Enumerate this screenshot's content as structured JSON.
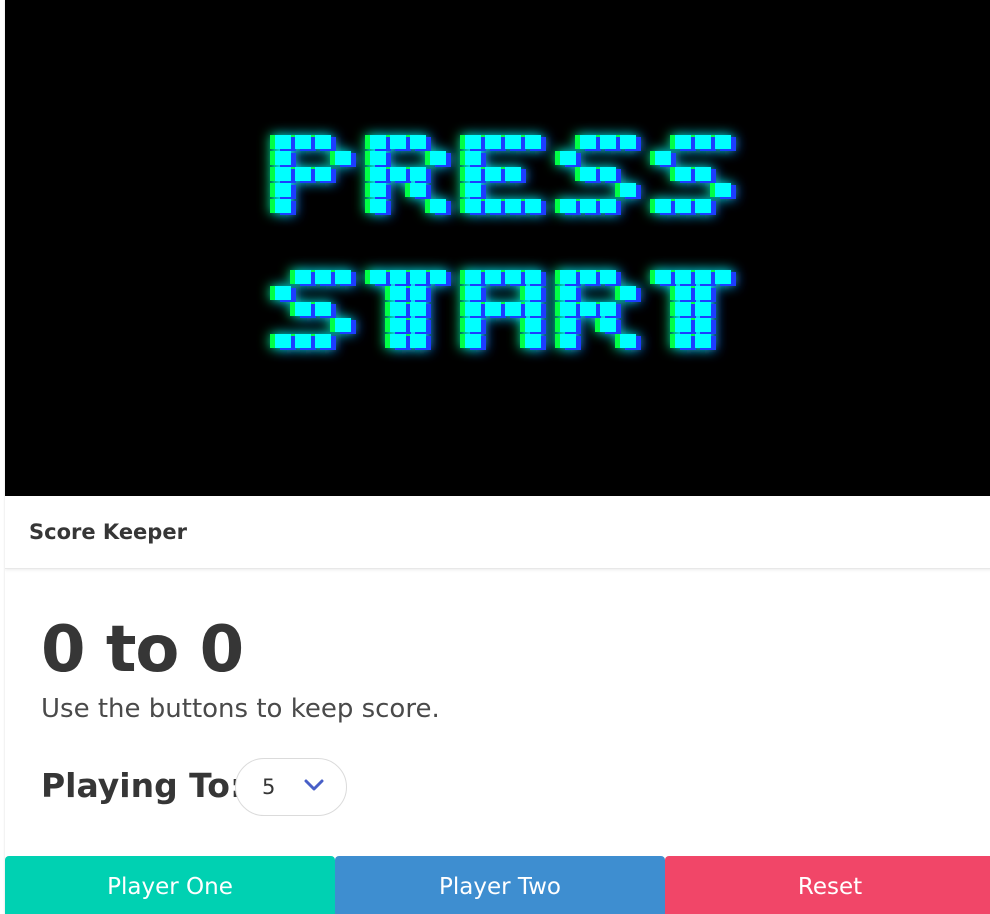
{
  "hero": {
    "text": "PRESS START",
    "colors": {
      "background": "#000000",
      "front": "#00ffff",
      "green": "#00ff44",
      "blue": "#1e3cff"
    }
  },
  "card": {
    "title": "Score Keeper"
  },
  "score": {
    "p1": 0,
    "p2": 0,
    "display": "0 to 0"
  },
  "subtitle": "Use the buttons to keep score.",
  "playing_to": {
    "label": "Playing To:",
    "selected": "5"
  },
  "buttons": {
    "player_one": "Player One",
    "player_two": "Player Two",
    "reset": "Reset"
  },
  "colors": {
    "player_one": "#00d1b2",
    "player_two": "#3e8ed0",
    "reset": "#f14668",
    "chevron": "#485fc7"
  }
}
